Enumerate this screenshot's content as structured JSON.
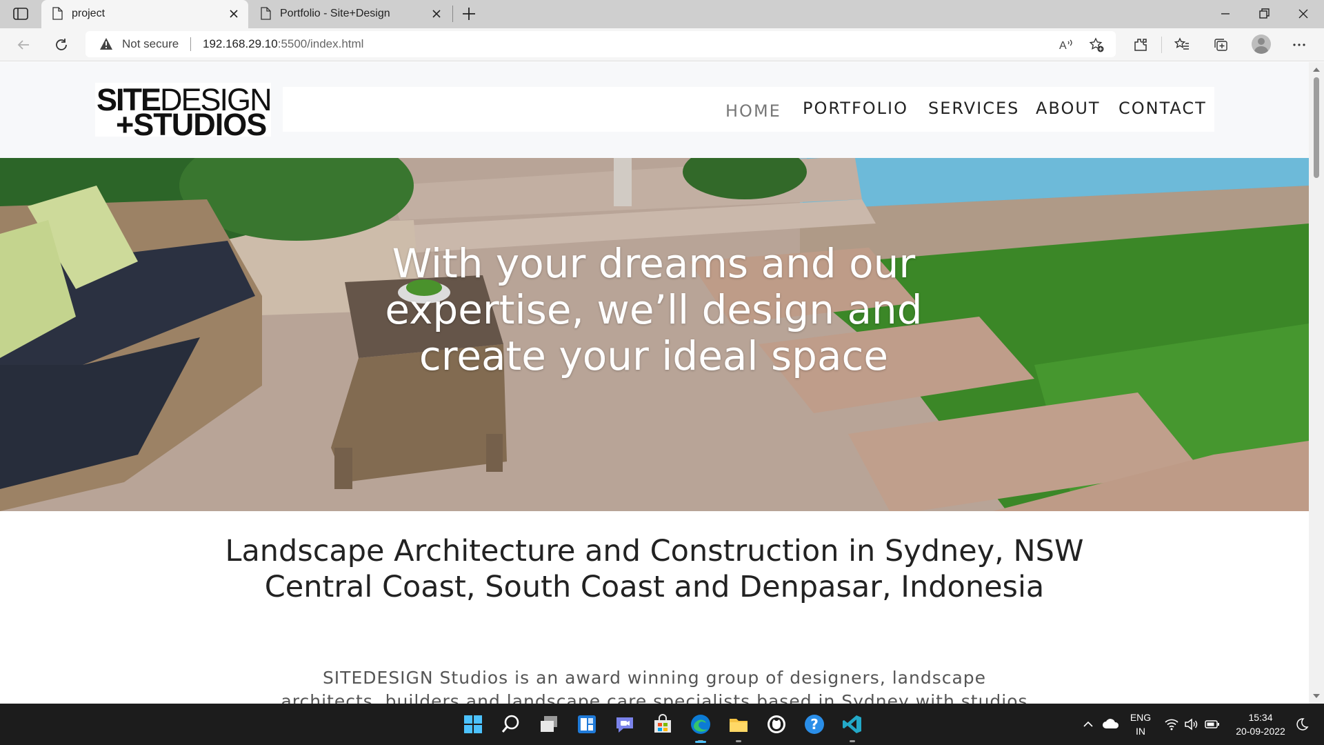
{
  "browser": {
    "tabs": [
      {
        "title": "project",
        "active": true
      },
      {
        "title": "Portfolio - Site+Design",
        "active": false
      }
    ],
    "security_label": "Not secure",
    "url_host": "192.168.29.10",
    "url_path": ":5500/index.html"
  },
  "site": {
    "logo": {
      "bold": "SITE",
      "light": "DESIGN",
      "line2": "+STUDIOS"
    },
    "nav": [
      {
        "label": "HOME",
        "active": true
      },
      {
        "label": "PORTFOLIO",
        "active": false
      },
      {
        "label": "SERVICES",
        "active": false
      },
      {
        "label": "ABOUT",
        "active": false
      },
      {
        "label": "CONTACT",
        "active": false
      }
    ],
    "hero_text": "With your dreams and our expertise, we’ll design and create your ideal space",
    "heading_line1": "Landscape Architecture and Construction in Sydney, NSW",
    "heading_line2": "Central Coast, South Coast and Denpasar, Indonesia",
    "para_line1": "SITEDESIGN Studios is an award winning group of designers, landscape",
    "para_line2": "architects, builders and landscape care specialists based in Sydney with studios"
  },
  "taskbar": {
    "apps": [
      "start-icon",
      "search-icon",
      "task-view-icon",
      "widgets-icon",
      "teams-chat-icon",
      "store-icon",
      "edge-icon",
      "file-explorer-icon",
      "github-icon",
      "help-icon",
      "vscode-icon"
    ],
    "lang_top": "ENG",
    "lang_bottom": "IN",
    "time": "15:34",
    "date": "20-09-2022"
  },
  "colors": {
    "edge_blue": "#0c7bd5",
    "vscode_teal": "#23a9c8",
    "grass": "#3f8f2a",
    "pool": "#4aaed6"
  }
}
